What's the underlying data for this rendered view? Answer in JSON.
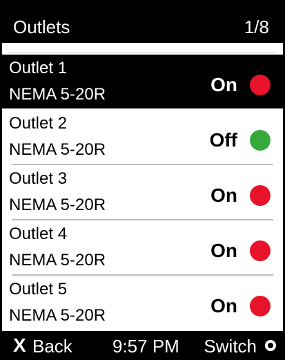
{
  "header": {
    "title": "Outlets",
    "page": "1/8"
  },
  "outlets": [
    {
      "name": "Outlet 1",
      "type": "NEMA 5-20R",
      "status": "On",
      "status_color": "#e8132a",
      "selected": true
    },
    {
      "name": "Outlet 2",
      "type": "NEMA 5-20R",
      "status": "Off",
      "status_color": "#35a93c",
      "selected": false
    },
    {
      "name": "Outlet 3",
      "type": "NEMA 5-20R",
      "status": "On",
      "status_color": "#e8132a",
      "selected": false
    },
    {
      "name": "Outlet 4",
      "type": "NEMA 5-20R",
      "status": "On",
      "status_color": "#e8132a",
      "selected": false
    },
    {
      "name": "Outlet 5",
      "type": "NEMA 5-20R",
      "status": "On",
      "status_color": "#e8132a",
      "selected": false
    }
  ],
  "footer": {
    "back_icon": "X",
    "back_label": "Back",
    "time": "9:57 PM",
    "switch_label": "Switch",
    "switch_icon": "circle-button-icon"
  }
}
